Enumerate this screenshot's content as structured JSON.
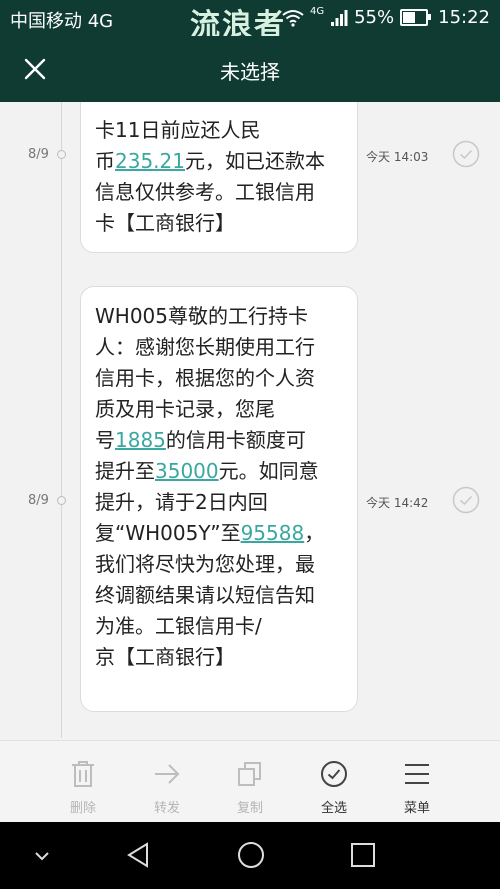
{
  "status_bar": {
    "carrier": "中国移动 4G",
    "watermark": "流浪者",
    "network": "4G",
    "battery": "55%",
    "battery_level": 0.55,
    "time": "15:22"
  },
  "header": {
    "title": "未选择"
  },
  "messages": [
    {
      "date": "8/9",
      "time": "今天 14:03",
      "lines": [
        [
          {
            "t": "卡11日前应还人民"
          }
        ],
        [
          {
            "t": "币"
          },
          {
            "t": "235.21",
            "link": true
          },
          {
            "t": "元，如已还款本"
          }
        ],
        [
          {
            "t": "信息仅供参考。工银信用"
          }
        ],
        [
          {
            "t": "卡【工商银行】"
          }
        ]
      ]
    },
    {
      "date": "8/9",
      "time": "今天 14:42",
      "lines": [
        [
          {
            "t": "WH005尊敬的工行持卡"
          }
        ],
        [
          {
            "t": "人：感谢您长期使用工行"
          }
        ],
        [
          {
            "t": "信用卡，根据您的个人资"
          }
        ],
        [
          {
            "t": "质及用卡记录，您尾"
          }
        ],
        [
          {
            "t": "号"
          },
          {
            "t": "1885",
            "link": true
          },
          {
            "t": "的信用卡额度可"
          }
        ],
        [
          {
            "t": "提升至"
          },
          {
            "t": "35000",
            "link": true
          },
          {
            "t": "元。如同意"
          }
        ],
        [
          {
            "t": "提升，请于2日内回"
          }
        ],
        [
          {
            "t": "复“WH005Y”至"
          },
          {
            "t": "95588",
            "link": true
          },
          {
            "t": "，"
          }
        ],
        [
          {
            "t": "我们将尽快为您处理，最"
          }
        ],
        [
          {
            "t": "终调额结果请以短信告知"
          }
        ],
        [
          {
            "t": "为准。工银信用卡/"
          }
        ],
        [
          {
            "t": "京【工商银行】"
          }
        ]
      ]
    }
  ],
  "toolbar": {
    "delete": "删除",
    "forward": "转发",
    "copy": "复制",
    "select_all": "全选",
    "menu": "菜单"
  },
  "icons": {
    "close": "close-icon",
    "check": "check-circle-icon",
    "delete": "trash-icon",
    "forward": "arrow-right-icon",
    "copy": "copy-icon",
    "select_all": "check-circle-icon",
    "menu": "hamburger-icon",
    "nav_down": "chevron-down-icon",
    "nav_back": "back-triangle-icon",
    "nav_home": "home-circle-icon",
    "nav_recent": "recent-square-icon"
  },
  "colors": {
    "header_bg": "#0f3b32",
    "link": "#3aa7a0",
    "background": "#f2f2f2"
  }
}
